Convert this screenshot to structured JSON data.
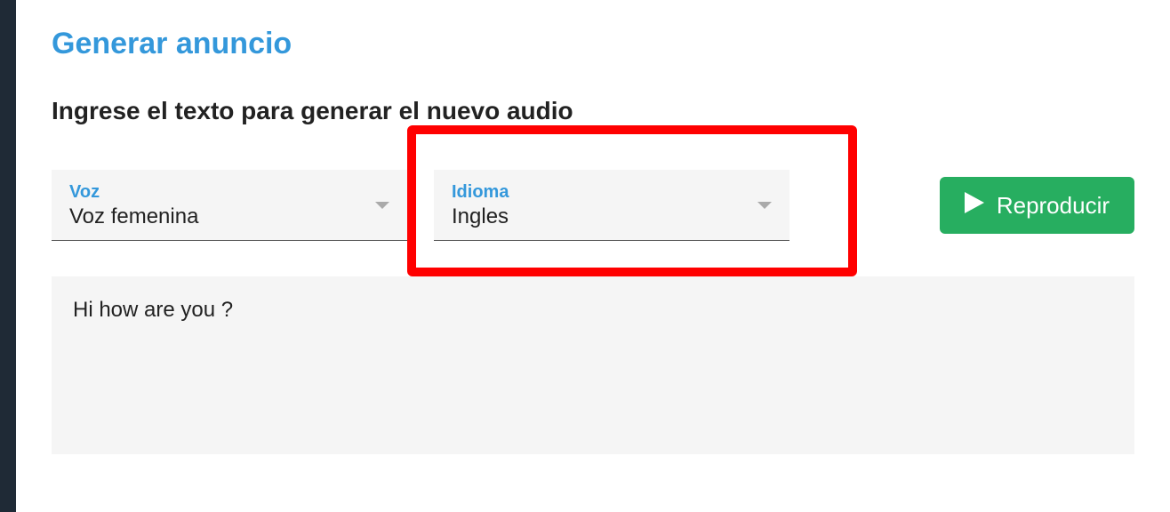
{
  "page": {
    "title": "Generar anuncio",
    "heading": "Ingrese el texto para generar el nuevo audio"
  },
  "voice": {
    "label": "Voz",
    "value": "Voz femenina"
  },
  "language": {
    "label": "Idioma",
    "value": "Ingles"
  },
  "play_button": {
    "label": "Reproducir"
  },
  "text_input": {
    "value": "Hi how are you ?"
  }
}
